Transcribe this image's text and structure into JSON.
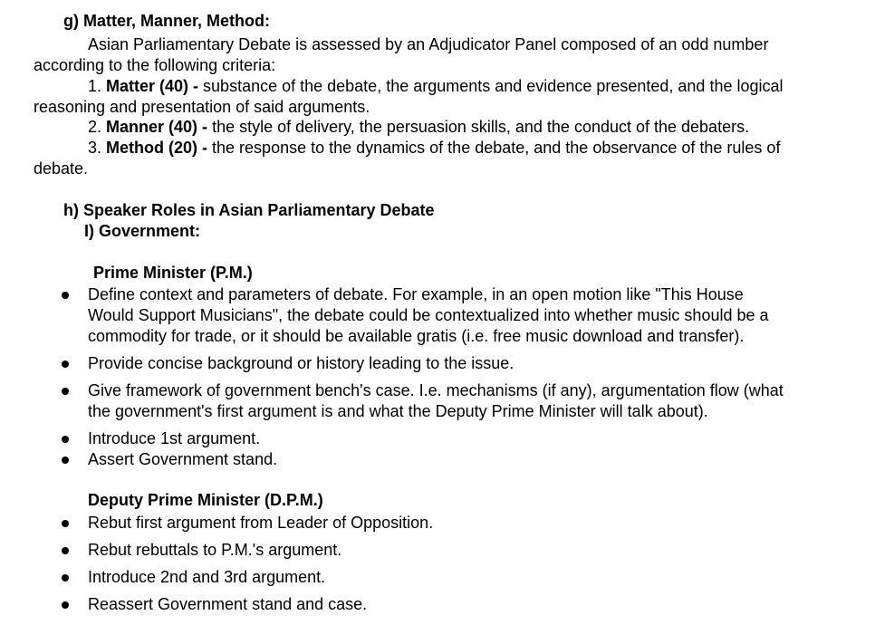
{
  "section_g": {
    "heading": "g) Matter, Manner, Method:",
    "intro_line1": "Asian Parliamentary Debate is assessed by an Adjudicator Panel composed of an odd number",
    "intro_line2": "according to the following criteria:",
    "criteria": [
      {
        "num": "1.",
        "name": "Matter (40) -",
        "desc_line1": " substance of the debate, the arguments and evidence presented, and the logical",
        "desc_line2": "reasoning and presentation of said arguments."
      },
      {
        "num": "2.",
        "name": "Manner (40) -",
        "desc_line1": " the style of delivery, the persuasion skills, and the conduct of the debaters."
      },
      {
        "num": "3.",
        "name": "Method (20) -",
        "desc_line1": " the response to the dynamics of the debate, and the observance of the rules of",
        "desc_line2": "debate."
      }
    ]
  },
  "section_h": {
    "heading": "h) Speaker Roles in Asian Parliamentary Debate",
    "subheading": "I) Government:",
    "pm": {
      "title": "Prime Minister (P.M.)",
      "bullets": [
        {
          "lines": [
            "Define context and parameters of debate. For example, in an open motion like \"This House",
            "Would Support Musicians\", the debate could be contextualized into whether music should be a",
            "commodity for trade, or it should be available gratis (i.e. free music download and transfer)."
          ]
        },
        {
          "lines": [
            "Provide concise background or history leading to the issue."
          ]
        },
        {
          "lines": [
            "Give framework of government bench's case. I.e. mechanisms (if any), argumentation flow (what",
            "the government's first argument is and what the Deputy Prime Minister will talk about)."
          ]
        },
        {
          "lines": [
            "Introduce 1st argument."
          ]
        },
        {
          "lines": [
            "Assert Government stand."
          ]
        }
      ]
    },
    "dpm": {
      "title": "Deputy Prime Minister (D.P.M.)",
      "bullets": [
        {
          "lines": [
            "Rebut first argument from Leader of Opposition."
          ]
        },
        {
          "lines": [
            "Rebut rebuttals to P.M.'s argument."
          ]
        },
        {
          "lines": [
            "Introduce 2nd and 3rd argument."
          ]
        },
        {
          "lines": [
            "Reassert Government stand and case."
          ]
        }
      ]
    }
  }
}
